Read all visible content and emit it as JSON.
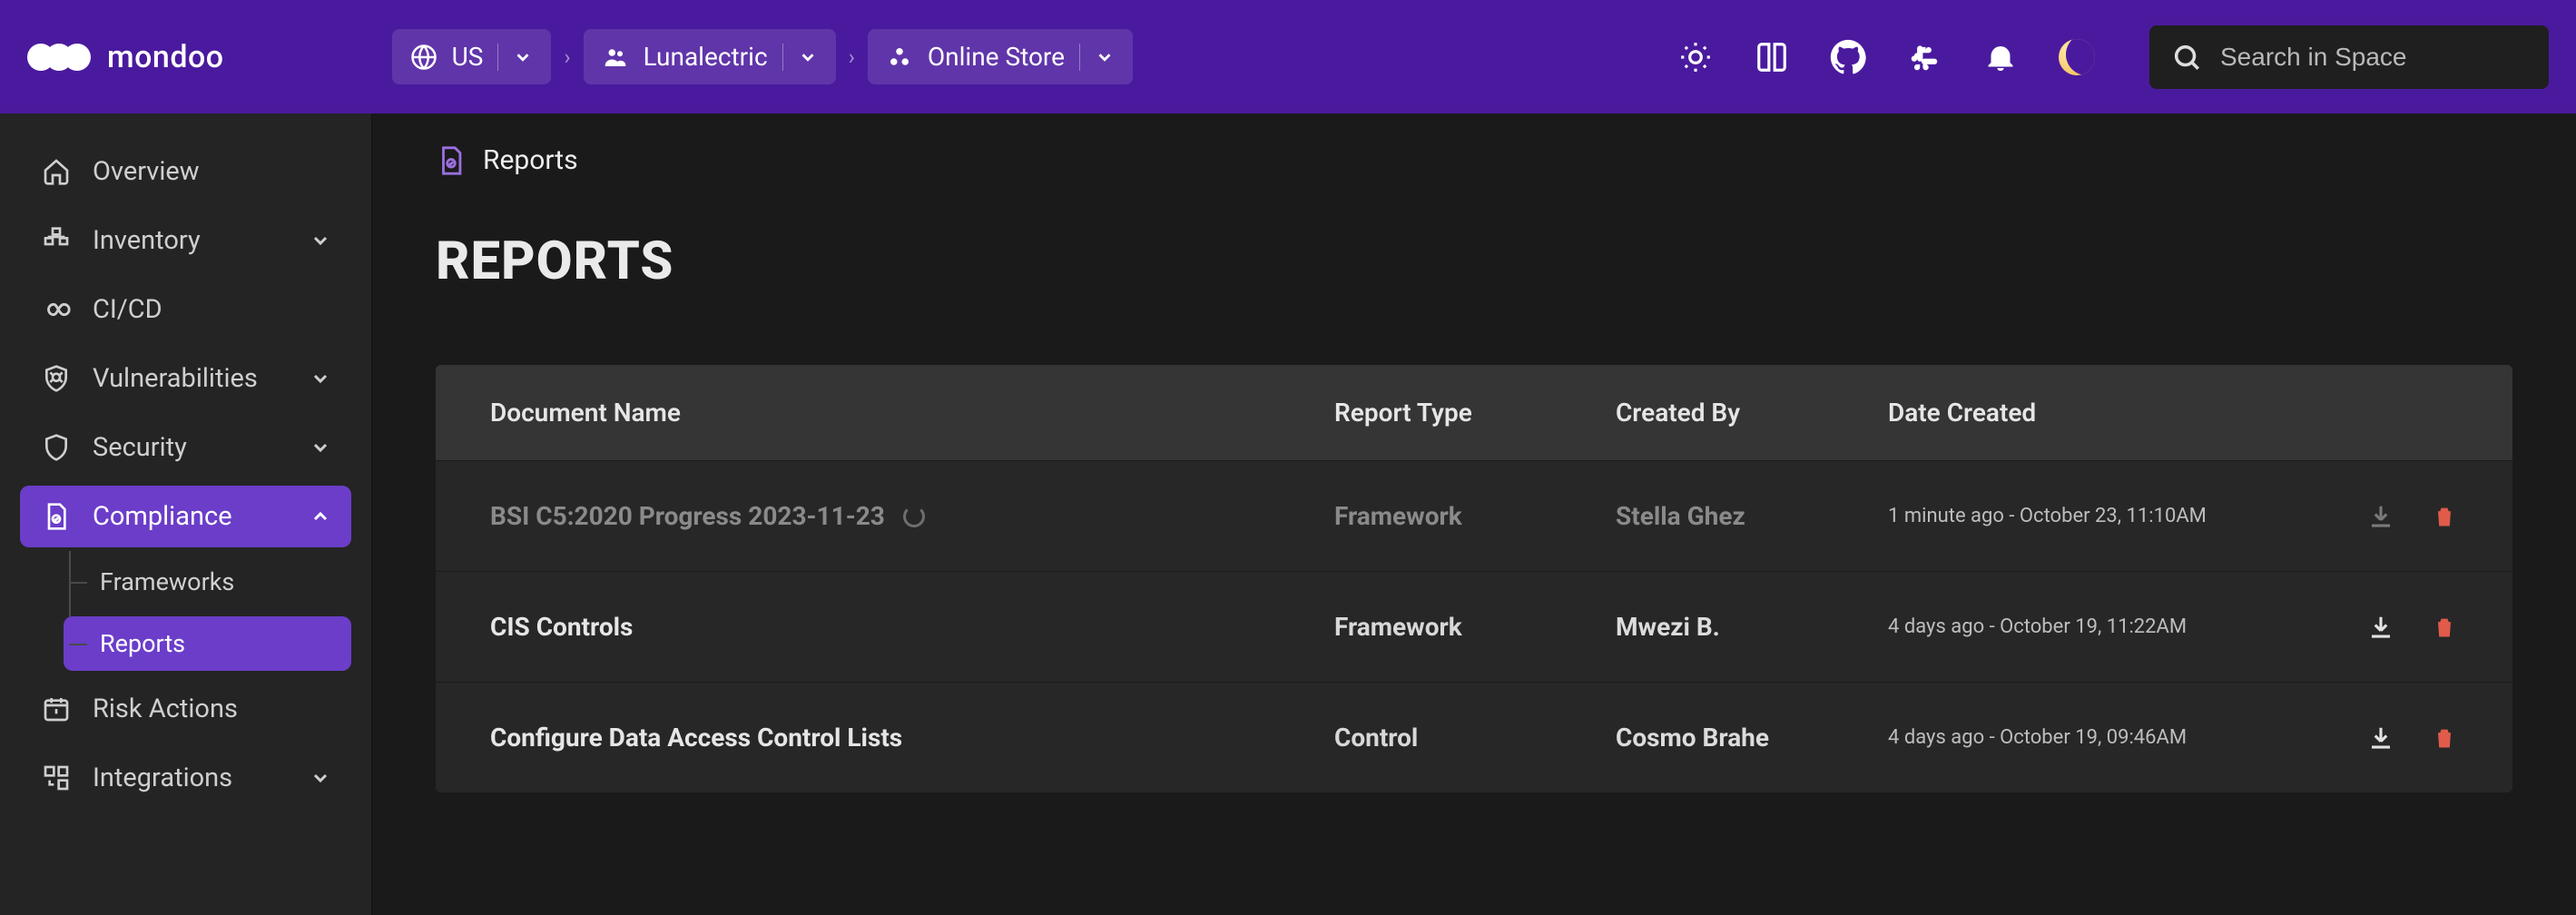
{
  "brand": {
    "name": "mondoo"
  },
  "header": {
    "region": "US",
    "org": "Lunalectric",
    "space": "Online Store",
    "search_placeholder": "Search in Space"
  },
  "sidebar": {
    "items": [
      {
        "key": "overview",
        "label": "Overview",
        "expandable": false
      },
      {
        "key": "inventory",
        "label": "Inventory",
        "expandable": true
      },
      {
        "key": "cicd",
        "label": "CI/CD",
        "expandable": false
      },
      {
        "key": "vulnerabilities",
        "label": "Vulnerabilities",
        "expandable": true
      },
      {
        "key": "security",
        "label": "Security",
        "expandable": true
      },
      {
        "key": "compliance",
        "label": "Compliance",
        "expandable": true,
        "active": true,
        "expanded": true,
        "children": [
          {
            "key": "frameworks",
            "label": "Frameworks"
          },
          {
            "key": "reports",
            "label": "Reports",
            "active": true
          }
        ]
      },
      {
        "key": "risk-actions",
        "label": "Risk Actions",
        "expandable": false
      },
      {
        "key": "integrations",
        "label": "Integrations",
        "expandable": true
      }
    ]
  },
  "page": {
    "breadcrumb": "Reports",
    "title": "REPORTS"
  },
  "table": {
    "headers": {
      "document": "Document Name",
      "type": "Report Type",
      "creator": "Created By",
      "date": "Date Created"
    },
    "rows": [
      {
        "document": "BSI C5:2020 Progress 2023-11-23",
        "type": "Framework",
        "creator": "Stella Ghez",
        "date": "1 minute ago - October 23, 11:10AM",
        "processing": true
      },
      {
        "document": "CIS Controls",
        "type": "Framework",
        "creator": "Mwezi B.",
        "date": "4 days ago - October 19, 11:22AM",
        "processing": false
      },
      {
        "document": "Configure Data Access Control Lists",
        "type": "Control",
        "creator": "Cosmo Brahe",
        "date": "4 days ago - October 19, 09:46AM",
        "processing": false
      }
    ]
  }
}
